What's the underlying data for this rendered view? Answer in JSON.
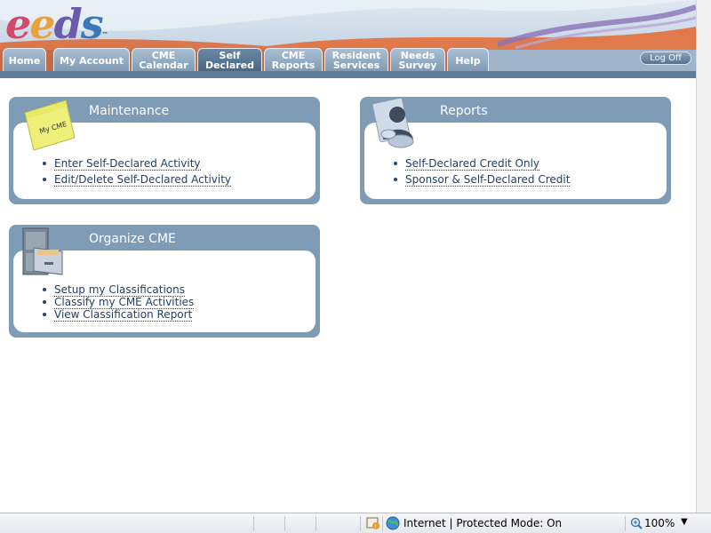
{
  "logo": {
    "text_parts": [
      "e",
      "e",
      "d",
      "s"
    ],
    "tm": "™"
  },
  "nav": {
    "tabs": [
      {
        "label": "Home",
        "active": false
      },
      {
        "label": "My Account",
        "active": false
      },
      {
        "label": "CME\nCalendar",
        "active": false
      },
      {
        "label": "Self\nDeclared",
        "active": true
      },
      {
        "label": "CME\nReports",
        "active": false
      },
      {
        "label": "Resident\nServices",
        "active": false
      },
      {
        "label": "Needs\nSurvey",
        "active": false
      },
      {
        "label": "Help",
        "active": false
      }
    ],
    "logoff_label": "Log Off"
  },
  "panels": {
    "maintenance": {
      "title": "Maintenance",
      "sticky_note": "My CME",
      "links": [
        "Enter Self-Declared Activity",
        "Edit/Delete Self-Declared Activity"
      ]
    },
    "reports": {
      "title": "Reports",
      "links": [
        "Self-Declared Credit Only",
        "Sponsor & Self-Declared Credit"
      ]
    },
    "organize": {
      "title": "Organize CME",
      "links": [
        "Setup my Classifications",
        "Classify my CME Activities",
        "View Classification Report"
      ]
    }
  },
  "statusbar": {
    "zone": "Internet | Protected Mode: On",
    "zoom": "100%"
  },
  "colors": {
    "panel": "#7f9cb7",
    "tab": "#8ea7bf",
    "tab_active": "#56728f",
    "link": "#1f3f66"
  }
}
